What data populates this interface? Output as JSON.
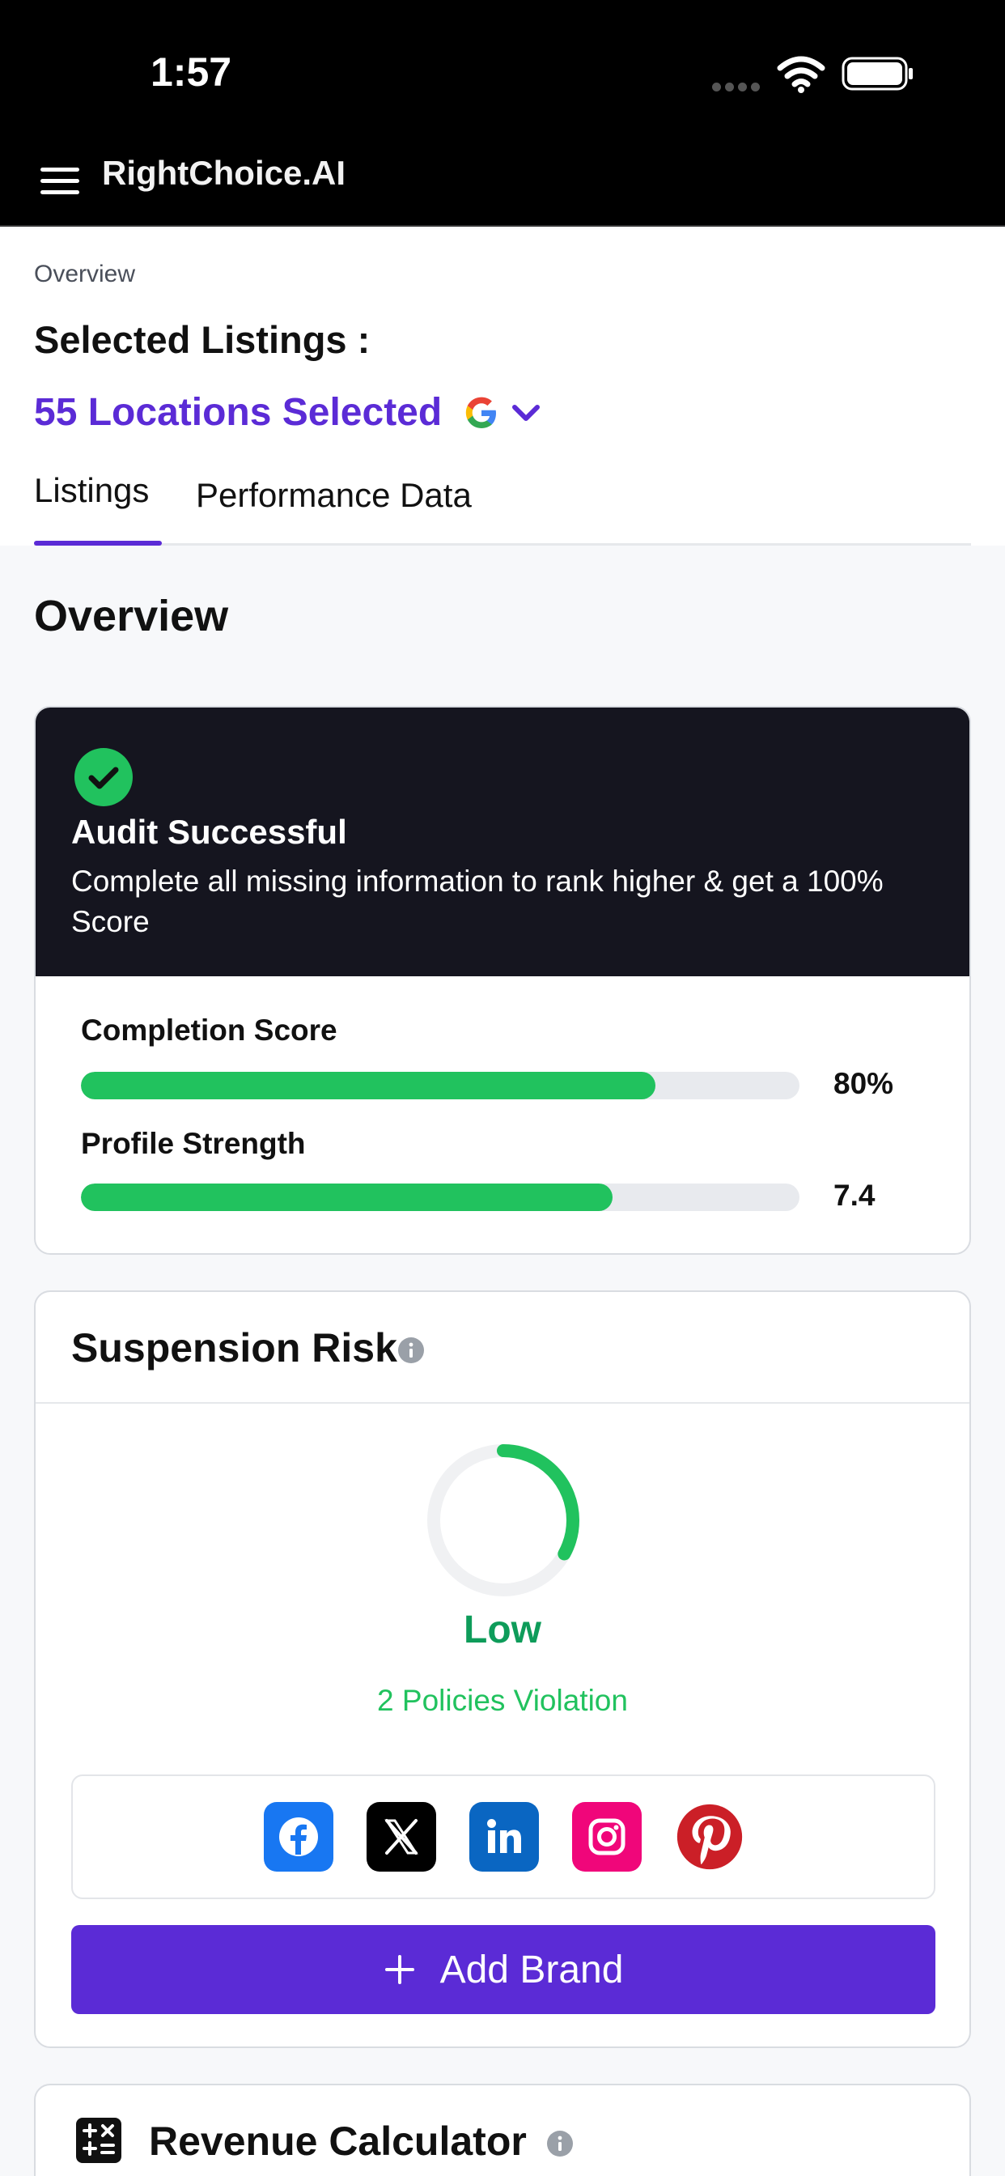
{
  "status_bar": {
    "time": "1:57"
  },
  "app_bar": {
    "title": "RightChoice.AI"
  },
  "header": {
    "breadcrumb": "Overview",
    "selected_title": "Selected Listings :",
    "locations": "55 Locations Selected"
  },
  "tabs": [
    {
      "label": "Listings",
      "active": true
    },
    {
      "label": "Performance Data",
      "active": false
    }
  ],
  "section_title": "Overview",
  "audit": {
    "title": "Audit Successful",
    "description": "Complete all missing information to rank higher & get a 100% Score",
    "metrics": [
      {
        "label": "Completion Score",
        "value": "80%",
        "fill_fraction": 0.8
      },
      {
        "label": "Profile Strength",
        "value": "7.4",
        "fill_fraction": 0.74
      }
    ]
  },
  "suspension_risk": {
    "title": "Suspension Risk",
    "level": "Low",
    "gauge_fraction": 0.33,
    "violation_text": "2 Policies Violation",
    "social_icons": [
      "facebook-icon",
      "x-twitter-icon",
      "linkedin-icon",
      "instagram-icon",
      "pinterest-icon"
    ],
    "add_button_label": "Add Brand"
  },
  "revenue_calculator": {
    "title": "Revenue Calculator"
  },
  "colors": {
    "accent": "#5b2bd6",
    "success": "#21c25e",
    "dark_header": "#15151f",
    "low_risk": "#0e9c5a"
  }
}
